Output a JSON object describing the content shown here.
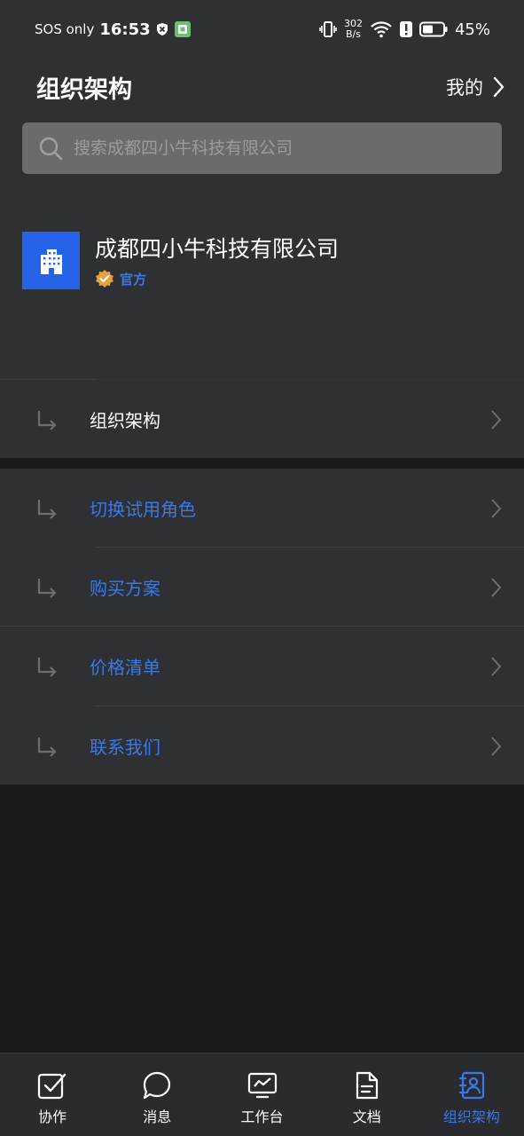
{
  "status_bar": {
    "sos": "SOS only",
    "time": "16:53",
    "net_speed_value": "302",
    "net_speed_unit": "B/s",
    "battery": "45%"
  },
  "header": {
    "title": "组织架构",
    "mine_label": "我的"
  },
  "search": {
    "placeholder": "搜索成都四小牛科技有限公司"
  },
  "company": {
    "name": "成都四小牛科技有限公司",
    "badge": "官方"
  },
  "menu": {
    "org": "组织架构",
    "items": [
      {
        "label": "切换试用角色"
      },
      {
        "label": "购买方案"
      },
      {
        "label": "价格清单"
      },
      {
        "label": "联系我们"
      }
    ]
  },
  "nav": {
    "items": [
      {
        "label": "协作",
        "icon": "check-square-icon"
      },
      {
        "label": "消息",
        "icon": "chat-bubble-icon"
      },
      {
        "label": "工作台",
        "icon": "monitor-chart-icon"
      },
      {
        "label": "文档",
        "icon": "document-icon"
      },
      {
        "label": "组织架构",
        "icon": "contacts-icon"
      }
    ]
  },
  "colors": {
    "accent": "#3a78ea",
    "logo_bg": "#2563e8",
    "badge_gold": "#e6a23c",
    "surface": "#2f3033",
    "background": "#1a1b1d"
  }
}
